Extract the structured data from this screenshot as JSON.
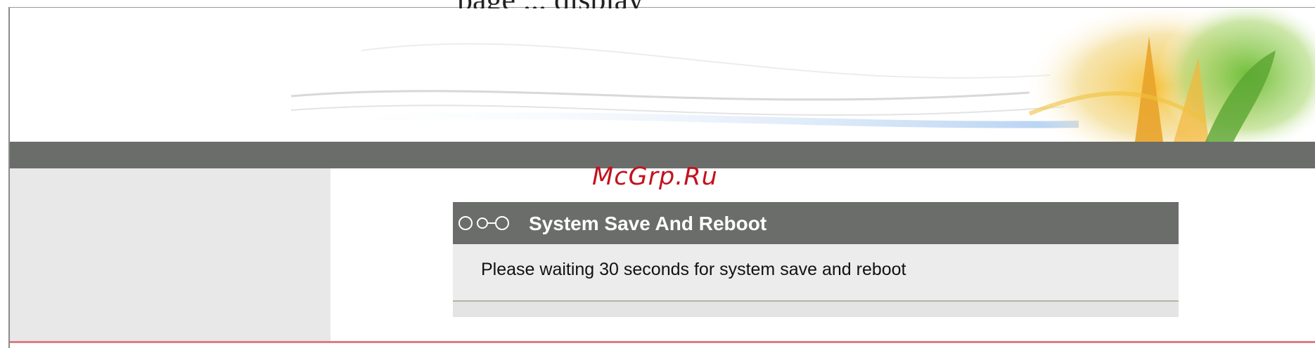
{
  "window": {
    "top_text": "page ... display"
  },
  "watermark": {
    "text": "McGrp.Ru"
  },
  "panel": {
    "title": "System Save And Reboot",
    "message": "Please waiting 30 seconds for system save and reboot",
    "icon": "chain-link-icon"
  },
  "colors": {
    "bar": "#6b6d6b",
    "sidebar": "#e8e8e8",
    "panel_body": "#ececec",
    "watermark": "#c3121e"
  }
}
